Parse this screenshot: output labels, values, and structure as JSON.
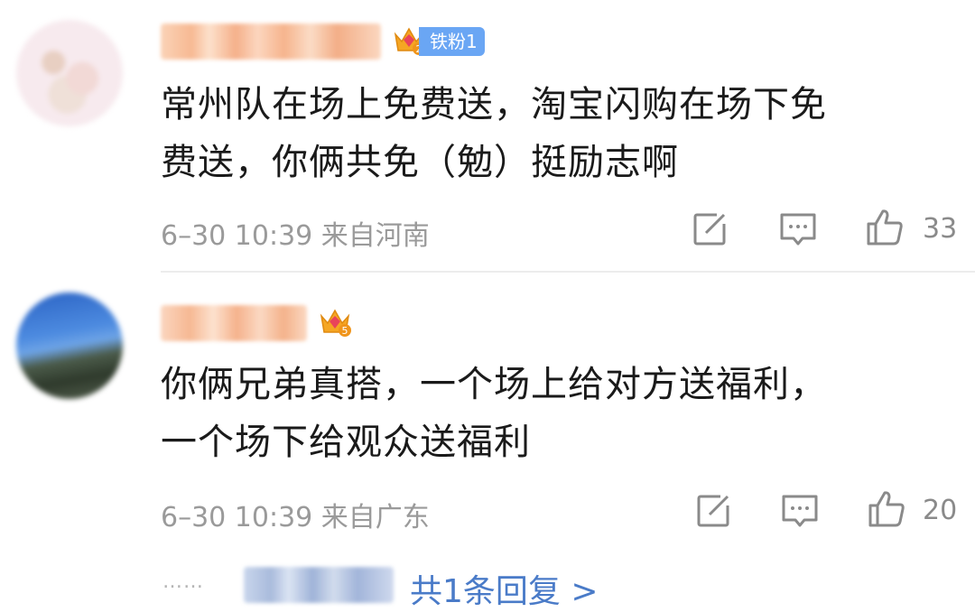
{
  "comments": [
    {
      "content_lines": [
        "常州队在场上免费送，淘宝闪购在场下免",
        "费送，你俩共免（勉）挺励志啊"
      ],
      "fan_badge": "铁粉1",
      "crown_level": "2",
      "meta": "6–30 10:39 来自河南",
      "likes": "33"
    },
    {
      "content_lines": [
        "你俩兄弟真搭，一个场上给对方送福利，",
        "一个场下给观众送福利"
      ],
      "crown_level": "5",
      "meta": "6–30 10:39 来自广东",
      "likes": "20"
    }
  ],
  "reply": {
    "dots": "……",
    "link_text": "共1条回复 >"
  },
  "colors": {
    "link": "#4a7bc8",
    "meta": "#9a9a9a",
    "badge": "#6aa6f4",
    "crown": "#f5a623",
    "crown_gem": "#e9445a"
  },
  "icons": [
    "edit-icon",
    "comment-icon",
    "thumbs-up-icon",
    "crown-icon"
  ]
}
